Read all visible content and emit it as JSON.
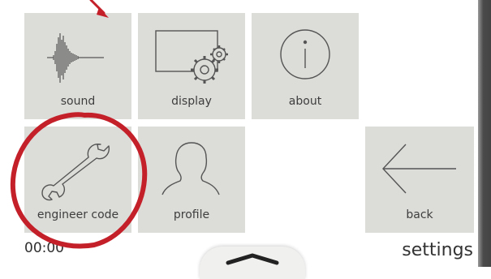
{
  "tiles": {
    "sound": "sound",
    "display": "display",
    "about": "about",
    "engineer_code": "engineer code",
    "profile": "profile",
    "back": "back"
  },
  "status_bar": {
    "time": "00:00",
    "title": "settings"
  },
  "annotation_color": "#c4202a",
  "icons": {
    "sound": "waveform-icon",
    "display": "monitor-gears-icon",
    "about": "info-icon",
    "engineer_code": "wrench-icon",
    "profile": "person-silhouette-icon",
    "back": "arrow-left-icon",
    "pull_tab": "chevron-up-icon"
  }
}
